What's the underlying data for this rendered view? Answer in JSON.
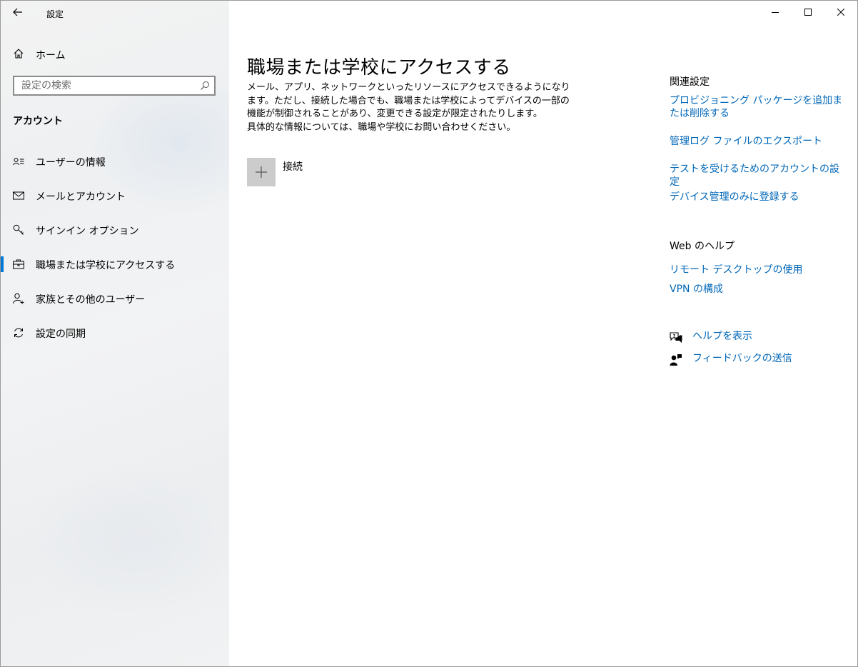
{
  "window": {
    "title": "設定"
  },
  "sidebar": {
    "home_label": "ホーム",
    "search": {
      "placeholder": "設定の検索",
      "value": ""
    },
    "section_title": "アカウント",
    "items": [
      {
        "label": "ユーザーの情報",
        "icon": "user-info-icon",
        "active": false
      },
      {
        "label": "メールとアカウント",
        "icon": "mail-icon",
        "active": false
      },
      {
        "label": "サインイン オプション",
        "icon": "key-icon",
        "active": false
      },
      {
        "label": "職場または学校にアクセスする",
        "icon": "briefcase-icon",
        "active": true
      },
      {
        "label": "家族とその他のユーザー",
        "icon": "add-user-icon",
        "active": false
      },
      {
        "label": "設定の同期",
        "icon": "sync-icon",
        "active": false
      }
    ]
  },
  "main": {
    "title": "職場または学校にアクセスする",
    "description": [
      "メール、アプリ、ネットワークといったリソースにアクセスできるようになります。ただし、接続した場合でも、職場または学校によってデバイスの一部の機能が制御されることがあり、変更できる設定が限定されたりします。",
      "具体的な情報については、職場や学校にお問い合わせください。"
    ],
    "connect_label": "接続"
  },
  "related": {
    "heading": "関連設定",
    "links": [
      "プロビジョニング パッケージを追加または削除する",
      "管理ログ ファイルのエクスポート",
      "テストを受けるためのアカウントの設定",
      "デバイス管理のみに登録する"
    ]
  },
  "web_help": {
    "heading": "Web のヘルプ",
    "links": [
      "リモート デスクトップの使用",
      "VPN の構成"
    ]
  },
  "footer_links": {
    "help": "ヘルプを表示",
    "feedback": "フィードバックの送信"
  },
  "colors": {
    "accent": "#0078d7",
    "link": "#0067b8",
    "sidebar_bg": "#f2f2f2"
  }
}
